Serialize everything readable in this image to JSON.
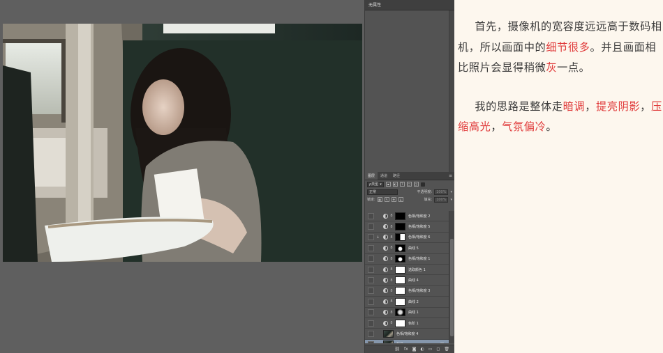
{
  "properties_panel": {
    "title": "无属性"
  },
  "layers_panel": {
    "tabs": [
      "图层",
      "通道",
      "路径"
    ],
    "filter_label": "ρ类型",
    "blend_mode": "正常",
    "opacity_label": "不透明度:",
    "opacity_value": "100%",
    "lock_label": "锁定:",
    "fill_label": "填充:",
    "fill_value": "100%",
    "layers": [
      {
        "name": "色相/饱和度 2",
        "mask": "black",
        "clip": false
      },
      {
        "name": "色相/饱和度 5",
        "mask": "black",
        "clip": false
      },
      {
        "name": "色相/饱和度 6",
        "mask": "shape",
        "clip": true
      },
      {
        "name": "曲线 5",
        "mask": "dark-spot",
        "clip": false
      },
      {
        "name": "色相/饱和度 1",
        "mask": "dark-spot",
        "clip": false
      },
      {
        "name": "选取颜色 1",
        "mask": "white",
        "clip": false
      },
      {
        "name": "曲线 4",
        "mask": "white",
        "clip": false
      },
      {
        "name": "色相/饱和度 3",
        "mask": "white",
        "clip": false
      },
      {
        "name": "曲线 2",
        "mask": "white",
        "clip": false
      },
      {
        "name": "曲线 1",
        "mask": "light-spot",
        "clip": false
      },
      {
        "name": "色阶 1",
        "mask": "white",
        "clip": false
      },
      {
        "name": "色相/饱和度 4",
        "mask": "image",
        "clip": false
      },
      {
        "name": "背景",
        "mask": "image",
        "clip": false,
        "selected": true
      }
    ],
    "footer_icons": [
      "link-icon",
      "fx-icon",
      "mask-icon",
      "adjustment-icon",
      "folder-icon",
      "new-layer-icon",
      "trash-icon"
    ]
  },
  "article": {
    "p1": {
      "a": "首先，摄像机的宽容度远远高于数码相机，所以画面中的",
      "b": "细节很多",
      "c": "。并且画面相比照片会显得稍微",
      "d": "灰",
      "e": "一点。"
    },
    "p2": {
      "a": "我的思路是整体走",
      "b": "暗调",
      "c": "，",
      "d": "提亮阴影",
      "e": "，",
      "f": "压缩高光",
      "g": "，",
      "h": "气氛偏冷",
      "i": "。"
    }
  },
  "colors": {
    "workspace": "#5f5f5f",
    "panel": "#535353",
    "selected_layer": "#8596ab",
    "article_bg": "#fdf7ee",
    "highlight": "#e03a3a"
  }
}
